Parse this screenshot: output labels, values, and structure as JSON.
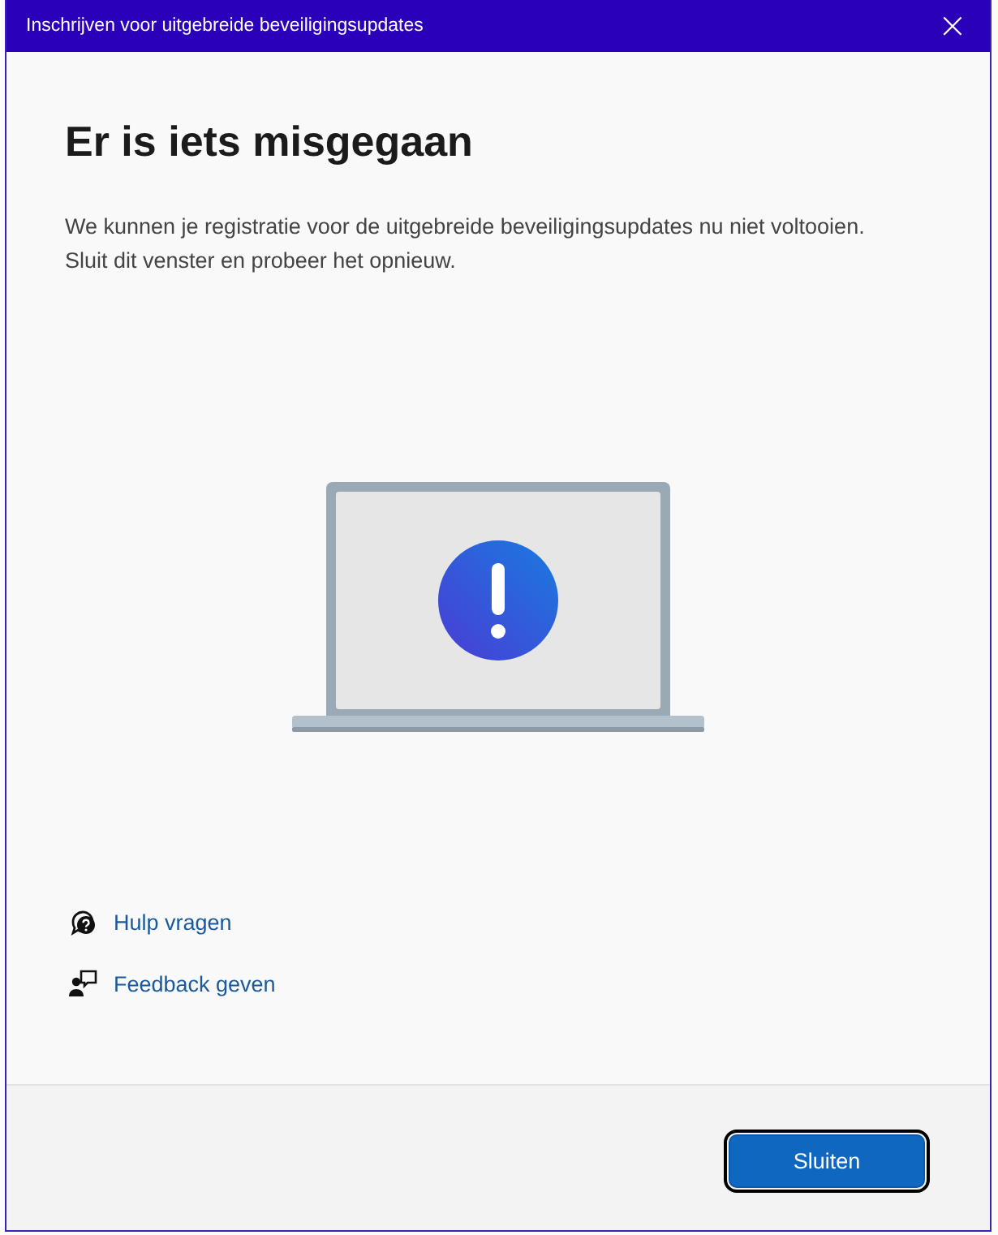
{
  "window": {
    "title": "Inschrijven voor uitgebreide beveiligingsupdates",
    "close": "×"
  },
  "heading": "Er is iets misgegaan",
  "message": [
    "We kunnen je registratie voor de uitgebreide beveiligingsupdates nu niet voltooien.",
    "Sluit dit venster en probeer het opnieuw."
  ],
  "links": [
    {
      "kind": "help",
      "label": "Hulp vragen"
    },
    {
      "kind": "feedback",
      "label": "Feedback geven"
    }
  ],
  "buttons": [
    {
      "label": "Sluiten",
      "focused": true
    }
  ]
}
